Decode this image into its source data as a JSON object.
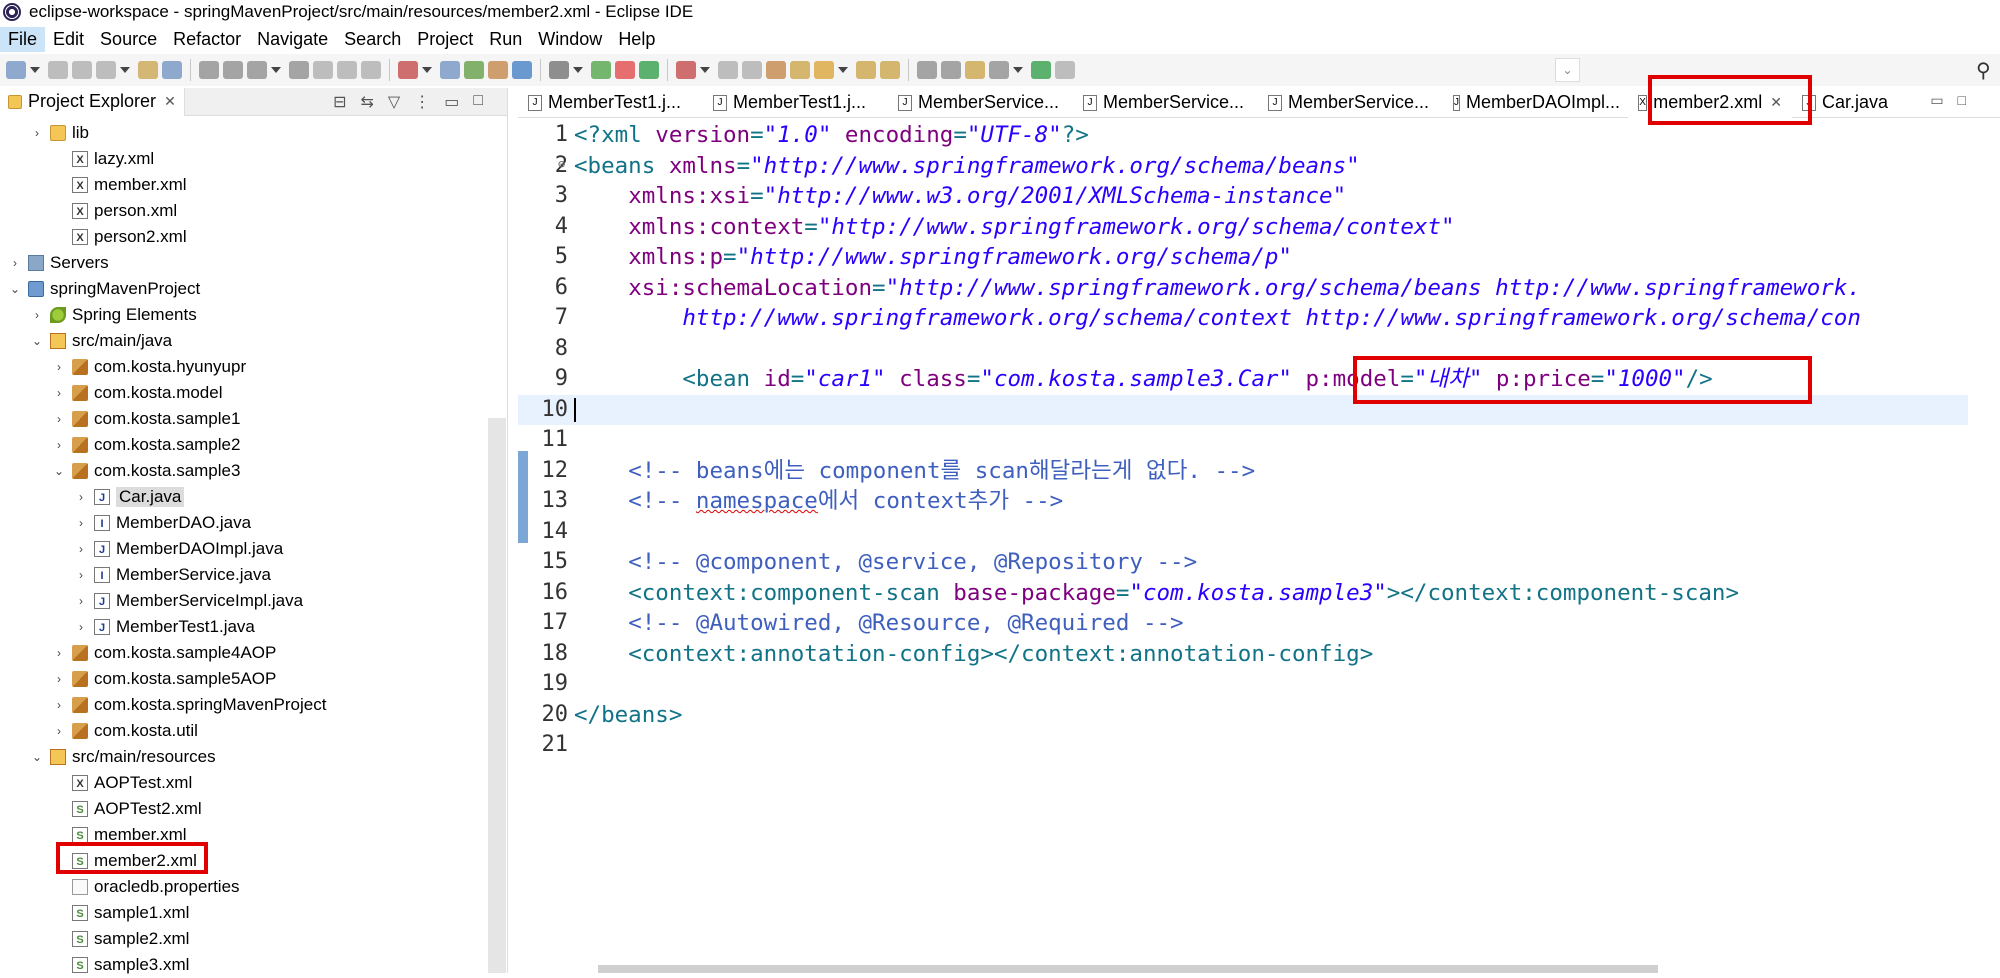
{
  "window": {
    "title": "eclipse-workspace - springMavenProject/src/main/resources/member2.xml - Eclipse IDE"
  },
  "menu": [
    "File",
    "Edit",
    "Source",
    "Refactor",
    "Navigate",
    "Search",
    "Project",
    "Run",
    "Window",
    "Help"
  ],
  "explorer": {
    "title": "Project Explorer",
    "items": [
      {
        "label": "lib",
        "icon": "folder-icon"
      },
      {
        "label": "lazy.xml",
        "icon": "xml-file-icon"
      },
      {
        "label": "member.xml",
        "icon": "xml-file-icon"
      },
      {
        "label": "person.xml",
        "icon": "xml-file-icon"
      },
      {
        "label": "person2.xml",
        "icon": "xml-file-icon"
      },
      {
        "label": "Servers",
        "icon": "servers-folder-icon"
      },
      {
        "label": "springMavenProject",
        "icon": "project-icon"
      },
      {
        "label": "Spring Elements",
        "icon": "spring-icon"
      },
      {
        "label": "src/main/java",
        "icon": "source-folder-icon"
      },
      {
        "label": "com.kosta.hyunyupr",
        "icon": "package-icon"
      },
      {
        "label": "com.kosta.model",
        "icon": "package-icon"
      },
      {
        "label": "com.kosta.sample1",
        "icon": "package-icon"
      },
      {
        "label": "com.kosta.sample2",
        "icon": "package-icon"
      },
      {
        "label": "com.kosta.sample3",
        "icon": "package-icon"
      },
      {
        "label": "Car.java",
        "icon": "java-file-icon"
      },
      {
        "label": "MemberDAO.java",
        "icon": "java-interface-icon"
      },
      {
        "label": "MemberDAOImpl.java",
        "icon": "java-file-icon"
      },
      {
        "label": "MemberService.java",
        "icon": "java-interface-icon"
      },
      {
        "label": "MemberServiceImpl.java",
        "icon": "java-file-icon"
      },
      {
        "label": "MemberTest1.java",
        "icon": "java-file-icon"
      },
      {
        "label": "com.kosta.sample4AOP",
        "icon": "package-icon"
      },
      {
        "label": "com.kosta.sample5AOP",
        "icon": "package-icon"
      },
      {
        "label": "com.kosta.springMavenProject",
        "icon": "package-icon"
      },
      {
        "label": "com.kosta.util",
        "icon": "package-icon"
      },
      {
        "label": "src/main/resources",
        "icon": "source-folder-icon"
      },
      {
        "label": "AOPTest.xml",
        "icon": "xml-file-icon"
      },
      {
        "label": "AOPTest2.xml",
        "icon": "spring-xml-file-icon"
      },
      {
        "label": "member.xml",
        "icon": "spring-xml-file-icon"
      },
      {
        "label": "member2.xml",
        "icon": "spring-xml-file-icon"
      },
      {
        "label": "oracledb.properties",
        "icon": "properties-file-icon"
      },
      {
        "label": "sample1.xml",
        "icon": "spring-xml-file-icon"
      },
      {
        "label": "sample2.xml",
        "icon": "spring-xml-file-icon"
      },
      {
        "label": "sample3.xml",
        "icon": "spring-xml-file-icon"
      }
    ]
  },
  "editor": {
    "tabs": [
      {
        "label": "MemberTest1.j..."
      },
      {
        "label": "MemberTest1.j..."
      },
      {
        "label": "MemberService..."
      },
      {
        "label": "MemberService..."
      },
      {
        "label": "MemberService..."
      },
      {
        "label": "MemberDAOImpl..."
      },
      {
        "label": "member2.xml",
        "active": true
      },
      {
        "label": "Car.java"
      }
    ],
    "lines": [
      {
        "n": "1",
        "parts": [
          [
            "punct",
            "<?"
          ],
          [
            "tag",
            "xml "
          ],
          [
            "attr",
            "version"
          ],
          [
            "punct",
            "="
          ],
          [
            "val",
            "\"1.0\""
          ],
          [
            "attr",
            " encoding"
          ],
          [
            "punct",
            "="
          ],
          [
            "val",
            "\"UTF-8\""
          ],
          [
            "punct",
            "?>"
          ]
        ]
      },
      {
        "n": "2",
        "fold": true,
        "parts": [
          [
            "punct",
            "<"
          ],
          [
            "tag",
            "beans "
          ],
          [
            "attr",
            "xmlns"
          ],
          [
            "punct",
            "="
          ],
          [
            "val",
            "\"http://www.springframework.org/schema/beans\""
          ]
        ]
      },
      {
        "n": "3",
        "parts": [
          [
            "plain",
            "    "
          ],
          [
            "attr",
            "xmlns:xsi"
          ],
          [
            "punct",
            "="
          ],
          [
            "val",
            "\"http://www.w3.org/2001/XMLSchema-instance\""
          ]
        ]
      },
      {
        "n": "4",
        "parts": [
          [
            "plain",
            "    "
          ],
          [
            "attr",
            "xmlns:context"
          ],
          [
            "punct",
            "="
          ],
          [
            "val",
            "\"http://www.springframework.org/schema/context\""
          ]
        ]
      },
      {
        "n": "5",
        "parts": [
          [
            "plain",
            "    "
          ],
          [
            "attr",
            "xmlns:p"
          ],
          [
            "punct",
            "="
          ],
          [
            "val",
            "\"http://www.springframework.org/schema/p\""
          ]
        ]
      },
      {
        "n": "6",
        "parts": [
          [
            "plain",
            "    "
          ],
          [
            "attr",
            "xsi:schemaLocation"
          ],
          [
            "punct",
            "="
          ],
          [
            "val",
            "\"http://www.springframework.org/schema/beans http://www.springframework."
          ]
        ]
      },
      {
        "n": "7",
        "parts": [
          [
            "plain",
            "        "
          ],
          [
            "val",
            "http://www.springframework.org/schema/context http://www.springframework.org/schema/con"
          ]
        ]
      },
      {
        "n": "8",
        "parts": []
      },
      {
        "n": "9",
        "parts": [
          [
            "plain",
            "        "
          ],
          [
            "punct",
            "<"
          ],
          [
            "tag",
            "bean "
          ],
          [
            "attr",
            "id"
          ],
          [
            "punct",
            "="
          ],
          [
            "val",
            "\"car1\""
          ],
          [
            "attr",
            " class"
          ],
          [
            "punct",
            "="
          ],
          [
            "val",
            "\"com.kosta.sample3.Car\""
          ],
          [
            "plain",
            " "
          ],
          [
            "attr",
            "p:model"
          ],
          [
            "punct",
            "="
          ],
          [
            "val",
            "\"내차\""
          ],
          [
            "attr",
            " p:price"
          ],
          [
            "punct",
            "="
          ],
          [
            "val",
            "\"1000\""
          ],
          [
            "punct",
            "/>"
          ]
        ]
      },
      {
        "n": "10",
        "current": true,
        "parts": []
      },
      {
        "n": "11",
        "parts": []
      },
      {
        "n": "12",
        "parts": [
          [
            "plain",
            "    "
          ],
          [
            "com",
            "<!-- beans에는 component를 scan해달라는게 없다. -->"
          ]
        ]
      },
      {
        "n": "13",
        "parts": [
          [
            "plain",
            "    "
          ],
          [
            "com",
            "<!-- "
          ],
          [
            "comsq",
            "namespace"
          ],
          [
            "com",
            "에서 context추가 -->"
          ]
        ]
      },
      {
        "n": "14",
        "parts": []
      },
      {
        "n": "15",
        "parts": [
          [
            "plain",
            "    "
          ],
          [
            "com",
            "<!-- @component, @service, @Repository -->"
          ]
        ]
      },
      {
        "n": "16",
        "parts": [
          [
            "plain",
            "    "
          ],
          [
            "punct",
            "<"
          ],
          [
            "tag",
            "context:component-scan "
          ],
          [
            "attr",
            "base-package"
          ],
          [
            "punct",
            "="
          ],
          [
            "val",
            "\"com.kosta.sample3\""
          ],
          [
            "punct",
            ">"
          ],
          [
            "punct",
            "</"
          ],
          [
            "tag",
            "context:component-scan"
          ],
          [
            "punct",
            ">"
          ]
        ]
      },
      {
        "n": "17",
        "parts": [
          [
            "plain",
            "    "
          ],
          [
            "com",
            "<!-- @Autowired, @Resource, @Required -->"
          ]
        ]
      },
      {
        "n": "18",
        "parts": [
          [
            "plain",
            "    "
          ],
          [
            "punct",
            "<"
          ],
          [
            "tag",
            "context:annotation-config"
          ],
          [
            "punct",
            ">"
          ],
          [
            "punct",
            "</"
          ],
          [
            "tag",
            "context:annotation-config"
          ],
          [
            "punct",
            ">"
          ]
        ]
      },
      {
        "n": "19",
        "parts": []
      },
      {
        "n": "20",
        "parts": [
          [
            "punct",
            "</"
          ],
          [
            "tag",
            "beans"
          ],
          [
            "punct",
            ">"
          ]
        ]
      },
      {
        "n": "21",
        "parts": []
      }
    ]
  },
  "colors": {
    "highlight_box": "#e00000",
    "current_line": "#e8f2fe",
    "xml_tag": "#127387",
    "xml_attr": "#7f007f",
    "xml_value": "#2a00ff",
    "xml_comment": "#3f5fbf"
  }
}
